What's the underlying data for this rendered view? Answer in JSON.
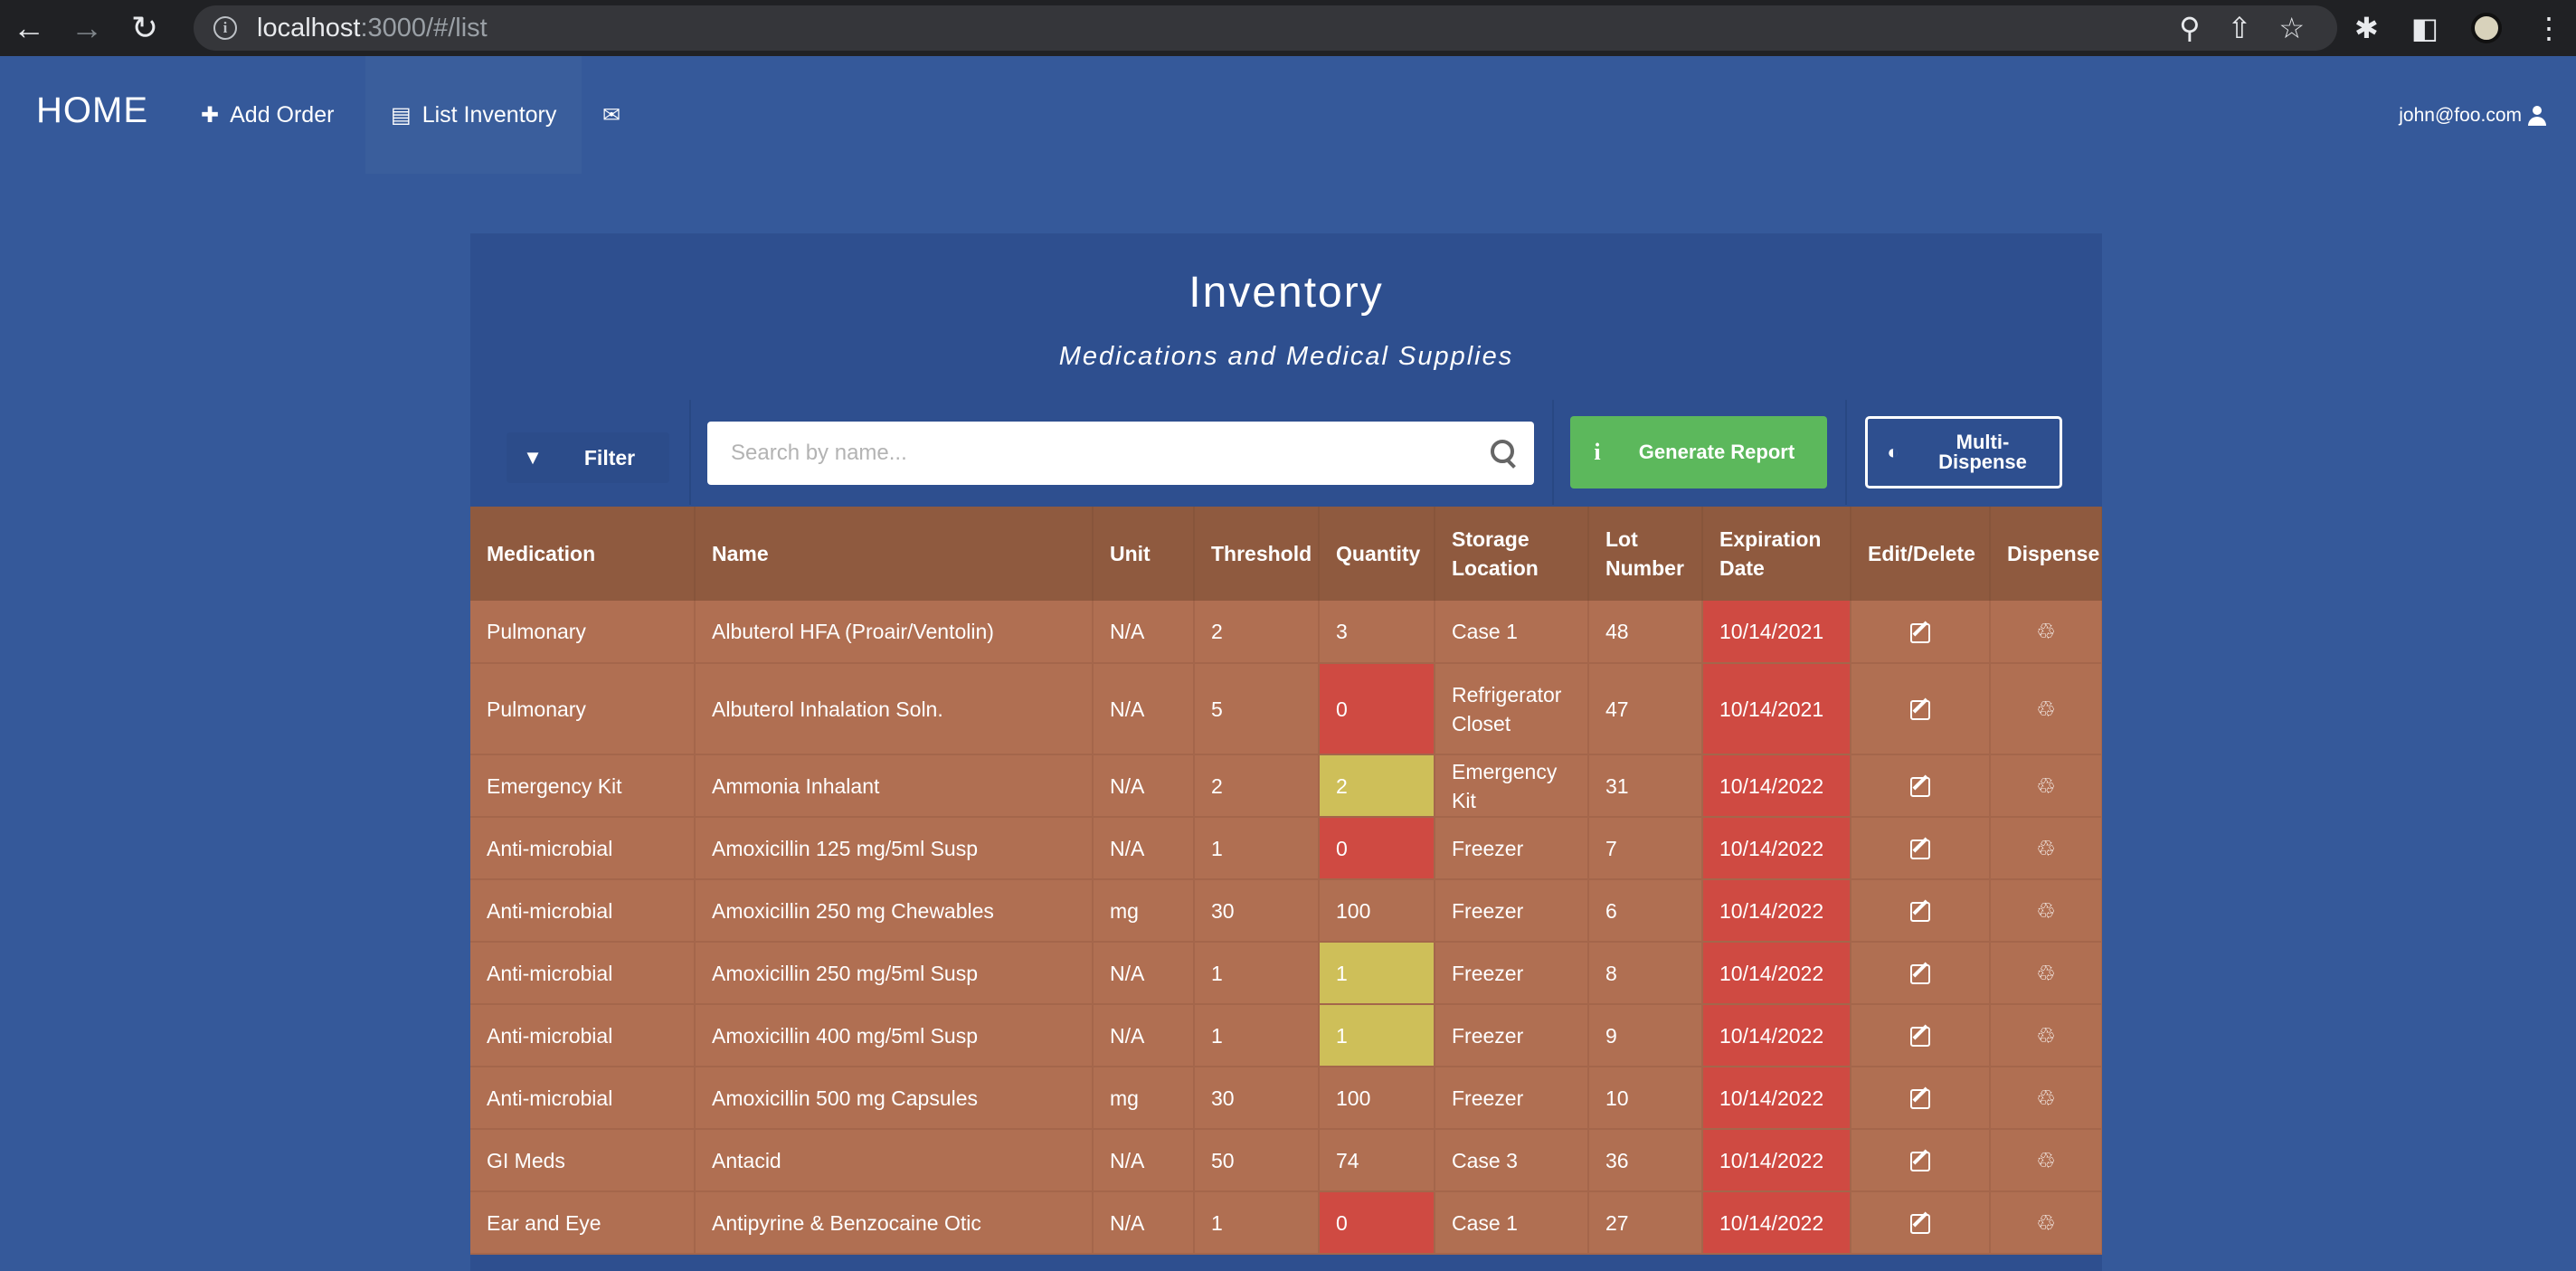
{
  "browser": {
    "url_host": "localhost",
    "url_path": ":3000/#/list"
  },
  "nav": {
    "brand": "HOME",
    "add_order": "Add Order",
    "list_inventory": "List Inventory",
    "user_email": "john@foo.com"
  },
  "panel": {
    "title": "Inventory",
    "subtitle": "Medications and Medical Supplies",
    "filter_label": "Filter",
    "search_placeholder": "Search by name...",
    "report_label": "Generate Report",
    "multi_dispense_label": "Multi-Dispense"
  },
  "table": {
    "headers": [
      "Medication",
      "Name",
      "Unit",
      "Threshold",
      "Quantity",
      "Storage Location",
      "Lot Number",
      "Expiration Date",
      "Edit/Delete",
      "Dispense"
    ],
    "rows": [
      {
        "medication": "Pulmonary",
        "name": "Albuterol HFA (Proair/Ventolin)",
        "unit": "N/A",
        "threshold": "2",
        "quantity": "3",
        "quantity_status": "ok",
        "storage": "Case 1",
        "lot": "48",
        "expiration": "10/14/2021"
      },
      {
        "medication": "Pulmonary",
        "name": "Albuterol Inhalation Soln.",
        "unit": "N/A",
        "threshold": "5",
        "quantity": "0",
        "quantity_status": "empty",
        "storage": "Refrigerator Closet",
        "lot": "47",
        "expiration": "10/14/2021"
      },
      {
        "medication": "Emergency Kit",
        "name": "Ammonia Inhalant",
        "unit": "N/A",
        "threshold": "2",
        "quantity": "2",
        "quantity_status": "low",
        "storage": "Emergency Kit",
        "lot": "31",
        "expiration": "10/14/2022"
      },
      {
        "medication": "Anti-microbial",
        "name": "Amoxicillin 125 mg/5ml Susp",
        "unit": "N/A",
        "threshold": "1",
        "quantity": "0",
        "quantity_status": "empty",
        "storage": "Freezer",
        "lot": "7",
        "expiration": "10/14/2022"
      },
      {
        "medication": "Anti-microbial",
        "name": "Amoxicillin 250 mg Chewables",
        "unit": "mg",
        "threshold": "30",
        "quantity": "100",
        "quantity_status": "ok",
        "storage": "Freezer",
        "lot": "6",
        "expiration": "10/14/2022"
      },
      {
        "medication": "Anti-microbial",
        "name": "Amoxicillin 250 mg/5ml Susp",
        "unit": "N/A",
        "threshold": "1",
        "quantity": "1",
        "quantity_status": "low",
        "storage": "Freezer",
        "lot": "8",
        "expiration": "10/14/2022"
      },
      {
        "medication": "Anti-microbial",
        "name": "Amoxicillin 400 mg/5ml Susp",
        "unit": "N/A",
        "threshold": "1",
        "quantity": "1",
        "quantity_status": "low",
        "storage": "Freezer",
        "lot": "9",
        "expiration": "10/14/2022"
      },
      {
        "medication": "Anti-microbial",
        "name": "Amoxicillin 500 mg Capsules",
        "unit": "mg",
        "threshold": "30",
        "quantity": "100",
        "quantity_status": "ok",
        "storage": "Freezer",
        "lot": "10",
        "expiration": "10/14/2022"
      },
      {
        "medication": "GI Meds",
        "name": "Antacid",
        "unit": "N/A",
        "threshold": "50",
        "quantity": "74",
        "quantity_status": "ok",
        "storage": "Case 3",
        "lot": "36",
        "expiration": "10/14/2022"
      },
      {
        "medication": "Ear and Eye",
        "name": "Antipyrine & Benzocaine Otic",
        "unit": "N/A",
        "threshold": "1",
        "quantity": "0",
        "quantity_status": "empty",
        "storage": "Case 1",
        "lot": "27",
        "expiration": "10/14/2022"
      }
    ]
  },
  "colors": {
    "page_bg": "#35599a",
    "panel_bg": "#2e4f8f",
    "table_header": "#8f5a3f",
    "table_row": "#b06f52",
    "expired": "#cf4a42",
    "low_stock": "#cebf59",
    "report_button": "#5cb85c"
  },
  "icons": {
    "add_order": "plus-icon",
    "list_inventory": "list-icon",
    "messages": "envelope-icon",
    "user": "user-icon",
    "filter": "funnel-icon",
    "search": "search-icon",
    "report": "info-icon",
    "multi_dispense": "pills-icon",
    "edit": "edit-icon",
    "dispense": "recycle-icon"
  }
}
